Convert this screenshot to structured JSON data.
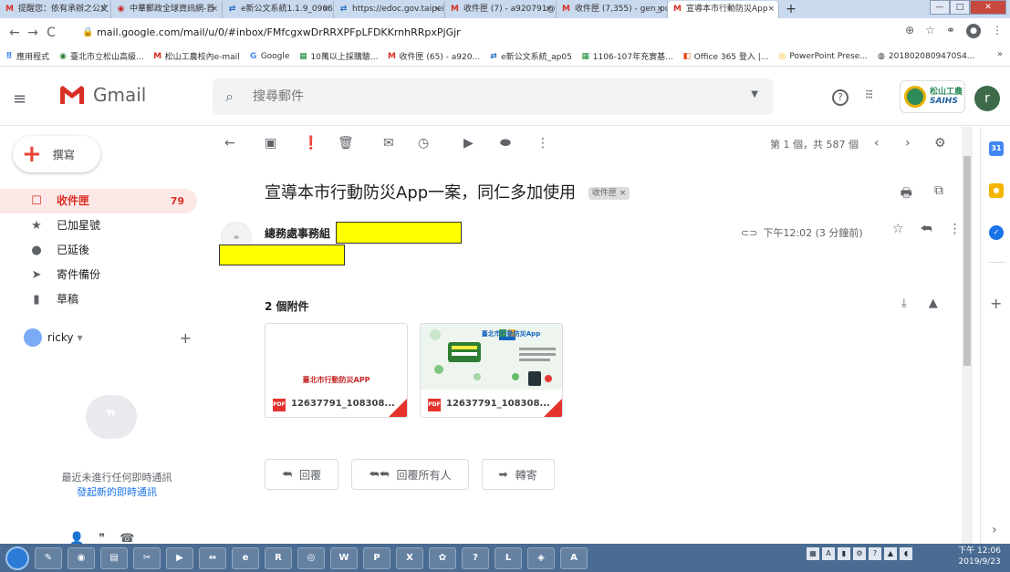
{
  "browser": {
    "tabs": [
      {
        "icon": "M",
        "icon_color": "#d93025",
        "label": "提醒您：依有承辦之公文"
      },
      {
        "icon": "◉",
        "icon_color": "#c62828",
        "label": "中華郵政全球資訊網-首"
      },
      {
        "icon": "⇄",
        "icon_color": "#1565c0",
        "label": "e新公文系統1.1.9_0906"
      },
      {
        "icon": "⇄",
        "icon_color": "#1565c0",
        "label": "https://edoc.gov.taipei/"
      },
      {
        "icon": "M",
        "icon_color": "#d93025",
        "label": "收件匣 (7) - a920791@g"
      },
      {
        "icon": "M",
        "icon_color": "#d93025",
        "label": "收件匣 (7,355) - gen_pu"
      },
      {
        "icon": "M",
        "icon_color": "#d93025",
        "label": "宣導本市行動防災App"
      }
    ],
    "new_tab": "+",
    "window_buttons": {
      "min": "—",
      "max": "□",
      "close": "✕"
    },
    "back": "←",
    "forward": "→",
    "reload": "C",
    "url": "mail.google.com/mail/u/0/#inbox/FMfcgxwDrRRXPFpLFDKKrnhRRpxPjGjr",
    "bookmarks": [
      {
        "icon": "⠿",
        "color": "#1a73e8",
        "label": "應用程式"
      },
      {
        "icon": "◉",
        "color": "#2e7d32",
        "label": "臺北市立松山高級..."
      },
      {
        "icon": "M",
        "color": "#d93025",
        "label": "松山工農校內e-mail"
      },
      {
        "icon": "G",
        "color": "#4285f4",
        "label": "Google"
      },
      {
        "icon": "▦",
        "color": "#1b8a3a",
        "label": "10萬以上採購驗..."
      },
      {
        "icon": "M",
        "color": "#d93025",
        "label": "收件匣 (65) - a920..."
      },
      {
        "icon": "⇄",
        "color": "#1565c0",
        "label": "e新公文系統_ap05"
      },
      {
        "icon": "▦",
        "color": "#1b8a3a",
        "label": "1106-107年充實基..."
      },
      {
        "icon": "◧",
        "color": "#e64a19",
        "label": "Office 365 登入 |..."
      },
      {
        "icon": "◎",
        "color": "#f4b400",
        "label": "PowerPoint Prese..."
      },
      {
        "icon": "◍",
        "color": "#333333",
        "label": "2018020809470S4..."
      }
    ],
    "bookmarks_more": "»"
  },
  "gmail": {
    "app_name": "Gmail",
    "search_placeholder": "搜尋郵件",
    "avatar_letter": "r",
    "school_logo_line1": "松山工農",
    "school_logo_line2": "SAIHS",
    "compose_label": "撰寫",
    "nav": [
      {
        "icon": "☐",
        "label": "收件匣",
        "count": "79",
        "active": true
      },
      {
        "icon": "★",
        "label": "已加星號",
        "count": "",
        "active": false
      },
      {
        "icon": "●",
        "label": "已延後",
        "count": "",
        "active": false
      },
      {
        "icon": "➤",
        "label": "寄件備份",
        "count": "",
        "active": false
      },
      {
        "icon": "▮",
        "label": "草稿",
        "count": "",
        "active": false
      }
    ],
    "hangouts_user": "ricky",
    "chat_empty": "最近未進行任何即時通訊",
    "chat_link": "發起新的即時通訊",
    "pager": "第 1 個，共 587 個",
    "subject": "宣導本市行動防災App一案，同仁多加使用",
    "label_chip": "收件匣 ×",
    "sender": "總務處事務組",
    "time": "下午12:02 (3 分鐘前)",
    "attachments_heading": "2 個附件",
    "attachments": [
      {
        "preview_text": "臺北市行動防災APP",
        "filename": "12637791_108308..."
      },
      {
        "preview_text": "臺北市行動防災App",
        "filename": "12637791_108308..."
      }
    ],
    "reply": "回覆",
    "reply_all": "回覆所有人",
    "forward": "轉寄"
  },
  "taskbar": {
    "time": "下午 12:06",
    "date": "2019/9/23"
  },
  "colors": {
    "gmail_red": "#d93025",
    "highlight": "#ffff00",
    "taskbar": "#4a6b92"
  }
}
